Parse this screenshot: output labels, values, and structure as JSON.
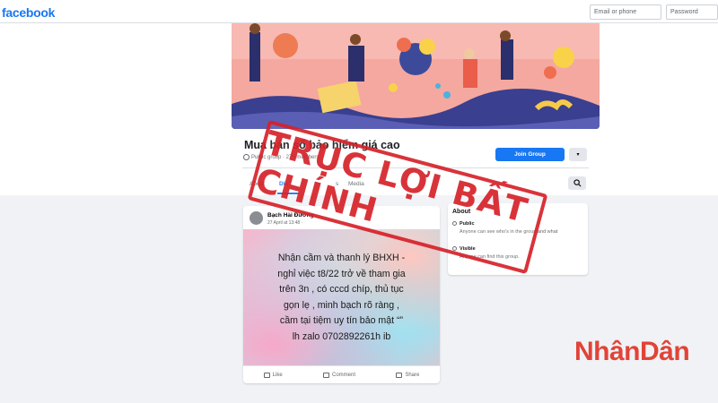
{
  "topbar": {
    "brand": "facebook",
    "email_placeholder": "Email or phone",
    "password_placeholder": "Password"
  },
  "group": {
    "title": "Mua bán sổ bảo hiểm giá cao",
    "meta": "Public group · 279 members",
    "join_label": "Join Group",
    "more_label": "▾"
  },
  "tabs": [
    {
      "label": "About",
      "active": false
    },
    {
      "label": "Dis",
      "active": true
    },
    {
      "label": "s",
      "active": false
    },
    {
      "label": "Media",
      "active": false
    }
  ],
  "post": {
    "author": "Bạch Hải Đường",
    "time": "27 April at 13:48 · ",
    "text": "Nhận cầm và thanh lý BHXH -\nnghỉ việc t8/22 trở về tham gia\ntrên 3n , có cccd chíp, thủ tục\ngọn lẹ , minh bạch rõ ràng ,\ncầm tại tiệm uy tín bảo mật “”\nlh zalo 0702892261h ib",
    "actions": {
      "like": "Like",
      "comment": "Comment",
      "share": "Share"
    }
  },
  "about": {
    "title": "About",
    "public_label": "Public",
    "public_desc": "Anyone can see who's in the group and what",
    "visible_label": "Visible",
    "visible_desc": "Anyone can find this group."
  },
  "overlay": {
    "stamp_text": "TRỤC LỢI BẤT CHÍNH",
    "stamp_color": "#d6222a",
    "watermark": "NhânDân"
  },
  "colors": {
    "brand": "#1877f2",
    "stamp": "#d6222a"
  }
}
